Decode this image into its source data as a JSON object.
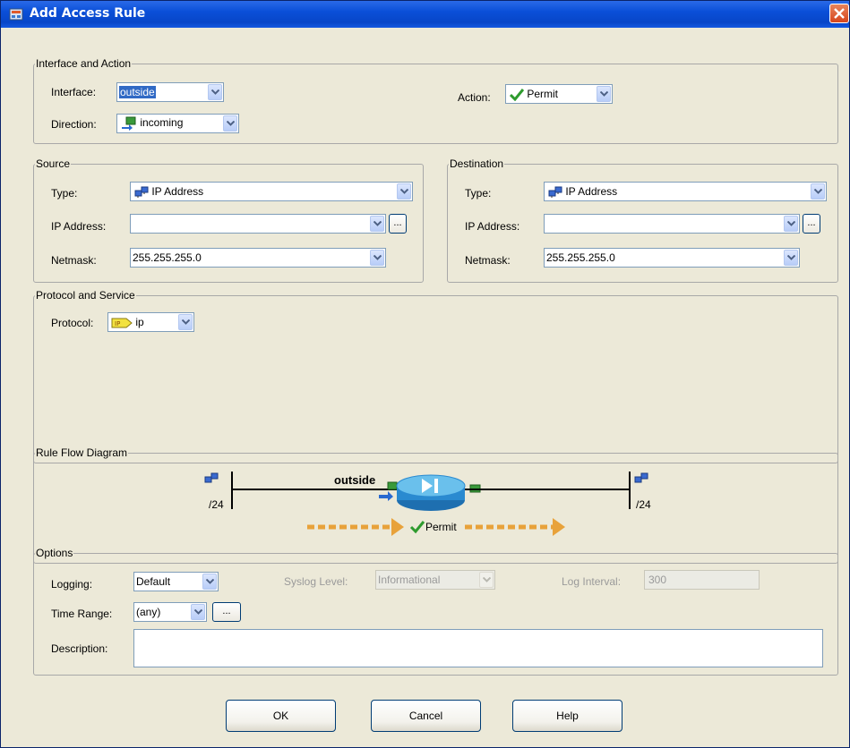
{
  "window": {
    "title": "Add Access Rule"
  },
  "interface_action": {
    "legend": "Interface and Action",
    "interface_label": "Interface:",
    "interface_value": "outside",
    "direction_label": "Direction:",
    "direction_value": "incoming",
    "action_label": "Action:",
    "action_value": "Permit"
  },
  "source": {
    "legend": "Source",
    "type_label": "Type:",
    "type_value": "IP Address",
    "ip_label": "IP Address:",
    "ip_value": "",
    "netmask_label": "Netmask:",
    "netmask_value": "255.255.255.0",
    "browse_label": "..."
  },
  "destination": {
    "legend": "Destination",
    "type_label": "Type:",
    "type_value": "IP Address",
    "ip_label": "IP Address:",
    "ip_value": "",
    "netmask_label": "Netmask:",
    "netmask_value": "255.255.255.0",
    "browse_label": "..."
  },
  "protocol": {
    "legend": "Protocol and Service",
    "protocol_label": "Protocol:",
    "protocol_value": "ip",
    "protocol_badge": "IP"
  },
  "flow": {
    "legend": "Rule Flow Diagram",
    "interface_label": "outside",
    "left_mask": "/24",
    "right_mask": "/24",
    "action_label": "Permit"
  },
  "options": {
    "legend": "Options",
    "logging_label": "Logging:",
    "logging_value": "Default",
    "syslog_label": "Syslog Level:",
    "syslog_value": "Informational",
    "interval_label": "Log Interval:",
    "interval_value": "300",
    "time_range_label": "Time Range:",
    "time_range_value": "(any)",
    "browse_label": "...",
    "description_label": "Description:",
    "description_value": ""
  },
  "buttons": {
    "ok": "OK",
    "cancel": "Cancel",
    "help": "Help"
  },
  "colors": {
    "titlebar": "#0a4fd8",
    "selection": "#316ac5",
    "permit_check": "#2e9b2e",
    "flow_arrow": "#e8a23a",
    "router": "#3aa0d8"
  }
}
